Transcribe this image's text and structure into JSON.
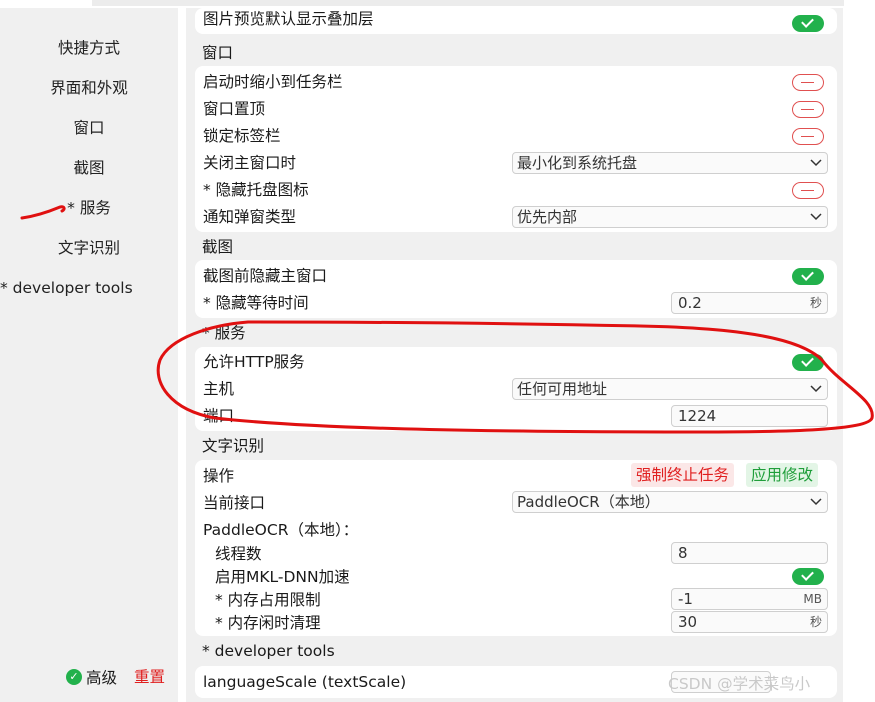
{
  "sidebar": {
    "items": [
      {
        "label": "快捷方式"
      },
      {
        "label": "界面和外观"
      },
      {
        "label": "窗口"
      },
      {
        "label": "截图"
      },
      {
        "label": "* 服务"
      },
      {
        "label": "文字识别"
      },
      {
        "label": "* developer tools"
      }
    ],
    "advanced_label": "高级",
    "reset_label": "重置"
  },
  "top_row": {
    "label": "图片预览默认显示叠加层",
    "enabled": true
  },
  "sections": {
    "window": {
      "title": "窗口",
      "minimize_to_tray": {
        "label": "启动时缩小到任务栏",
        "enabled": false
      },
      "always_on_top": {
        "label": "窗口置顶",
        "enabled": false
      },
      "lock_tabs": {
        "label": "锁定标签栏",
        "enabled": false
      },
      "on_close": {
        "label": "关闭主窗口时",
        "value": "最小化到系统托盘"
      },
      "hide_tray": {
        "label": "* 隐藏托盘图标",
        "enabled": false
      },
      "notify_type": {
        "label": "通知弹窗类型",
        "value": "优先内部"
      }
    },
    "screenshot": {
      "title": "截图",
      "hide_before": {
        "label": "截图前隐藏主窗口",
        "enabled": true
      },
      "hide_wait": {
        "label": "* 隐藏等待时间",
        "value": "0.2",
        "unit": "秒"
      }
    },
    "service": {
      "title": "* 服务",
      "allow_http": {
        "label": "允许HTTP服务",
        "enabled": true
      },
      "host": {
        "label": "主机",
        "value": "任何可用地址"
      },
      "port": {
        "label": "端口",
        "value": "1224"
      }
    },
    "ocr": {
      "title": "文字识别",
      "ops": {
        "label": "操作",
        "stop_label": "强制终止任务",
        "apply_label": "应用修改"
      },
      "engine": {
        "label": "当前接口",
        "value": "PaddleOCR（本地）"
      },
      "paddle_header": "PaddleOCR（本地）：",
      "threads": {
        "label": "线程数",
        "value": "8"
      },
      "mkldnn": {
        "label": "启用MKL-DNN加速",
        "enabled": true
      },
      "mem_limit": {
        "label": "* 内存占用限制",
        "value": "-1",
        "unit": "MB"
      },
      "idle_clean": {
        "label": "* 内存闲时清理",
        "value": "30",
        "unit": "秒"
      }
    },
    "dev": {
      "title": "* developer tools",
      "language_scale": {
        "label": "languageScale (textScale)"
      }
    }
  },
  "watermark": "CSDN @学术菜鸟小",
  "colors": {
    "toggle_on": "#22b14c",
    "toggle_off": "#e05050",
    "annotation": "#e01010",
    "panel_bg": "#f0f0f0"
  }
}
